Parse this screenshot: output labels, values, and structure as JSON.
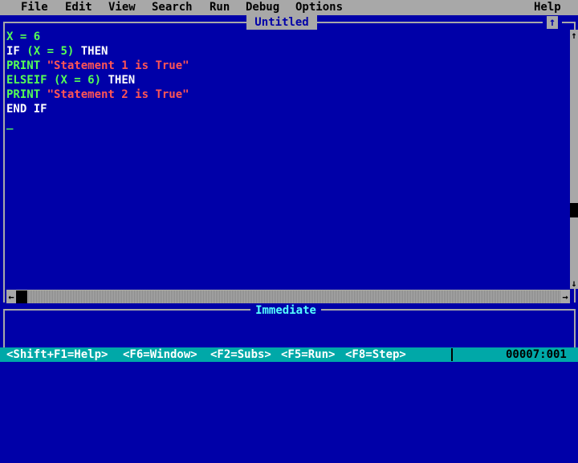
{
  "menu": {
    "items": [
      "File",
      "Edit",
      "View",
      "Search",
      "Run",
      "Debug",
      "Options"
    ],
    "help": "Help"
  },
  "editor": {
    "title": "Untitled",
    "maximize_glyph": "↑",
    "lines": [
      [
        {
          "t": "X = 6",
          "c": "var"
        }
      ],
      [
        {
          "t": "IF ",
          "c": "kw"
        },
        {
          "t": "(X = 5)",
          "c": "var"
        },
        {
          "t": " THEN",
          "c": "kw"
        }
      ],
      [
        {
          "t": "PRINT ",
          "c": "var"
        },
        {
          "t": "\"Statement 1 is True\"",
          "c": "str"
        }
      ],
      [
        {
          "t": "ELSEIF ",
          "c": "var"
        },
        {
          "t": "(X = 6)",
          "c": "var"
        },
        {
          "t": " THEN",
          "c": "kw"
        }
      ],
      [
        {
          "t": "PRINT ",
          "c": "var"
        },
        {
          "t": "\"Statement 2 is True\"",
          "c": "str"
        }
      ],
      [
        {
          "t": "END IF",
          "c": "kw"
        }
      ]
    ],
    "cursor": "_"
  },
  "scroll": {
    "up": "↑",
    "down": "↓",
    "left": "←",
    "right": "→"
  },
  "immediate": {
    "title": "Immediate"
  },
  "status": {
    "hints": [
      "<Shift+F1=Help>",
      "<F6=Window>",
      "<F2=Subs>",
      "<F5=Run>",
      "<F8=Step>"
    ],
    "position": "00007:001"
  },
  "colors": {
    "background": "#0000a8",
    "chrome": "#a8a8a8",
    "statusbar": "#00a8a8",
    "keyword": "#ffffff",
    "variable": "#55ff55",
    "string": "#ff5555"
  }
}
